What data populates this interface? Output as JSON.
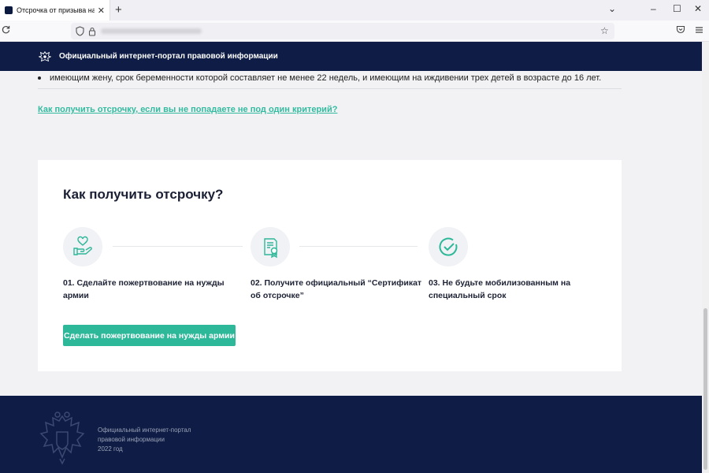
{
  "browser": {
    "tab_title": "Отсрочка от призыва на срочную",
    "tab_close": "✕",
    "new_tab": "+",
    "window_controls": {
      "chevron": "⌄",
      "minimize": "–",
      "maximize": "☐",
      "close": "✕"
    }
  },
  "header": {
    "site_name": "Официальный интернет-портал правовой информации"
  },
  "content": {
    "bullet_text": "имеющим жену, срок беременности которой составляет не менее 22 недель, и имеющим на иждивении трех детей в возрасте до 16 лет.",
    "help_link": "Как получить отсрочку, если вы не попадаете не под один критерий?"
  },
  "card": {
    "title": "Как получить отсрочку?",
    "steps": [
      {
        "icon": "heart-hand-icon",
        "line1": "01. Сделайте пожертвование на нужды",
        "line2": "армии"
      },
      {
        "icon": "certificate-icon",
        "line1": "02. Получите официальный “Сертификат",
        "line2": "об отсрочке”"
      },
      {
        "icon": "checkmark-circle-icon",
        "line1": "03. Не будьте мобилизованным на",
        "line2": "специальный срок"
      }
    ],
    "button_label": "Сделать пожертвование на нужды армии"
  },
  "footer": {
    "line1": "Официальный интернет-портал",
    "line2": "правовой информации",
    "line3": "2022 год"
  },
  "colors": {
    "navy": "#0e1c46",
    "accent": "#2db899",
    "link": "#33bba0"
  }
}
